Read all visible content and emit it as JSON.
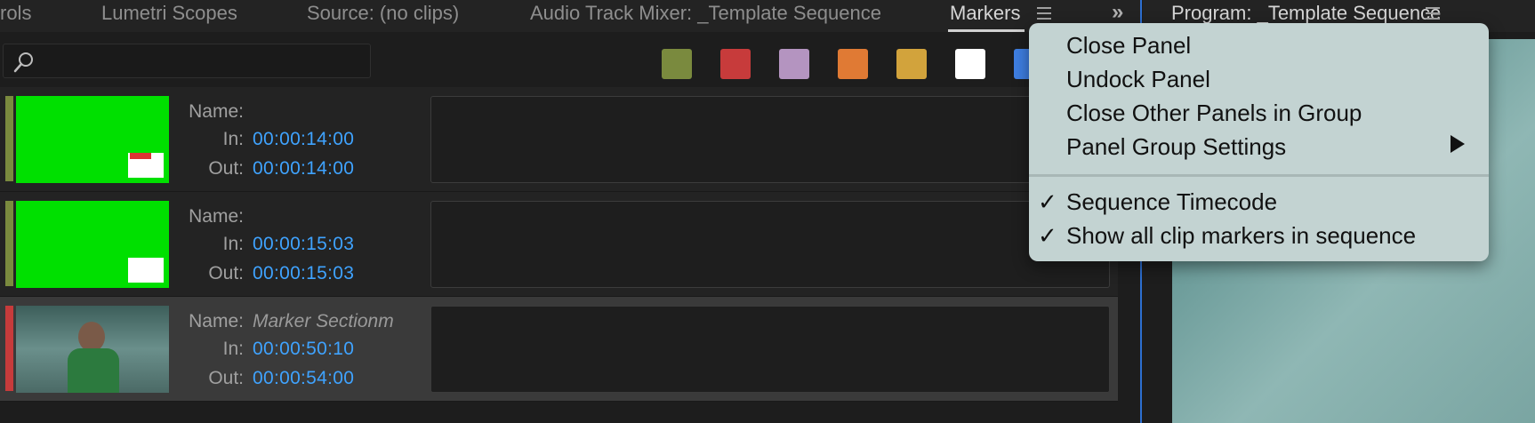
{
  "tabs": [
    {
      "label": "rols"
    },
    {
      "label": "Lumetri Scopes"
    },
    {
      "label": "Source: (no clips)"
    },
    {
      "label": "Audio Track Mixer: _Template Sequence"
    },
    {
      "label": "Markers"
    }
  ],
  "active_tab": "Markers",
  "program_panel": {
    "title": "Program: _Template Sequence"
  },
  "search": {
    "placeholder": ""
  },
  "color_filters": [
    "#7a8a3e",
    "#c73b3b",
    "#b494c0",
    "#e07a34",
    "#d2a33c",
    "#ffffff",
    "#3f7fe3"
  ],
  "markers": [
    {
      "name_label": "Name:",
      "name": "",
      "in_label": "In:",
      "in": "00:00:14:00",
      "out_label": "Out:",
      "out": "00:00:14:00",
      "color": "#7a8a3e",
      "selected": false
    },
    {
      "name_label": "Name:",
      "name": "",
      "in_label": "In:",
      "in": "00:00:15:03",
      "out_label": "Out:",
      "out": "00:00:15:03",
      "color": "#7a8a3e",
      "selected": false
    },
    {
      "name_label": "Name:",
      "name": "Marker Sectionm",
      "in_label": "In:",
      "in": "00:00:50:10",
      "out_label": "Out:",
      "out": "00:00:54:00",
      "color": "#c73b3b",
      "selected": true
    }
  ],
  "context_menu": {
    "items": [
      {
        "label": "Close Panel",
        "checked": false
      },
      {
        "label": "Undock Panel",
        "checked": false
      },
      {
        "label": "Close Other Panels in Group",
        "checked": false
      },
      {
        "label": "Panel Group Settings",
        "checked": false,
        "submenu": true
      },
      {
        "label": "Sequence Timecode",
        "checked": true
      },
      {
        "label": "Show all clip markers in sequence",
        "checked": true
      }
    ],
    "check_glyph": "✓"
  },
  "colors": {
    "timecode": "#3fa3ff",
    "accent_divider": "#2d6fd1",
    "menu_bg": "#c3d3d2"
  }
}
